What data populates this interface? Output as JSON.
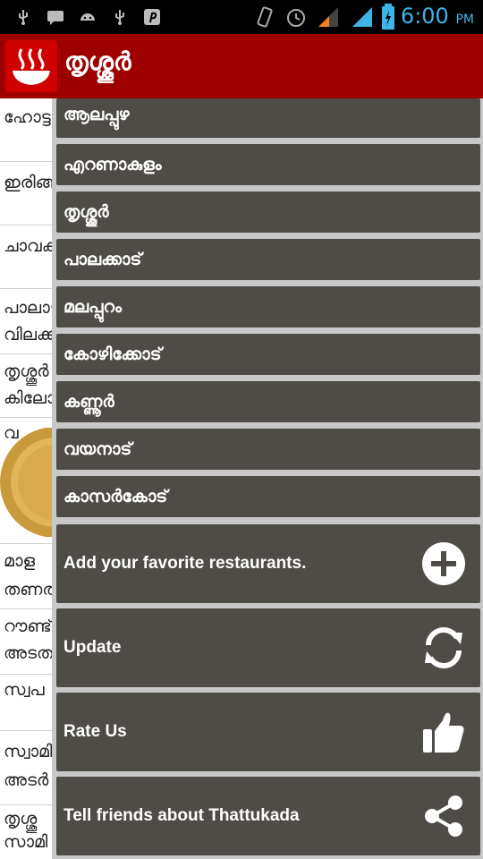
{
  "status_bar": {
    "time": "6:00",
    "ampm": "PM"
  },
  "header": {
    "title": "തൃശ്ശൂർ",
    "logo": "steaming-bowl-icon"
  },
  "background_list": [
    "ഹോട്ടൽ",
    "ഇരിങ്ങാലക്കുട",
    "ചാവക്കാട്",
    "പാലാഴി",
    "വിലക്ക",
    "തൃശ്ശൂർ",
    "കിലോ",
    "വ",
    "മാള",
    "തണത",
    "റൗണ്ട്",
    "അടത",
    "സ്വപ",
    "സ്വാമി",
    "അടർ",
    "തൃശ്ശൂ",
    "സാമി"
  ],
  "districts": [
    "ആലപ്പുഴ",
    "എറണാകുളം",
    "തൃശ്ശൂർ",
    "പാലക്കാട്",
    "മലപ്പുറം",
    "കോഴിക്കോട്",
    "കണ്ണൂർ",
    "വയനാട്",
    "കാസർകോട്"
  ],
  "actions": {
    "add": {
      "label": "Add your favorite restaurants.",
      "icon": "plus-circle-icon"
    },
    "update": {
      "label": "Update",
      "icon": "refresh-icon"
    },
    "rate": {
      "label": "Rate Us",
      "icon": "thumbs-up-icon"
    },
    "share": {
      "label": "Tell friends about Thattukada",
      "icon": "share-icon"
    }
  },
  "colors": {
    "header": "#9e0000",
    "drawer_item": "#4f4c47",
    "drawer_bg": "#c8c8c8",
    "clock": "#3fb4e6"
  }
}
